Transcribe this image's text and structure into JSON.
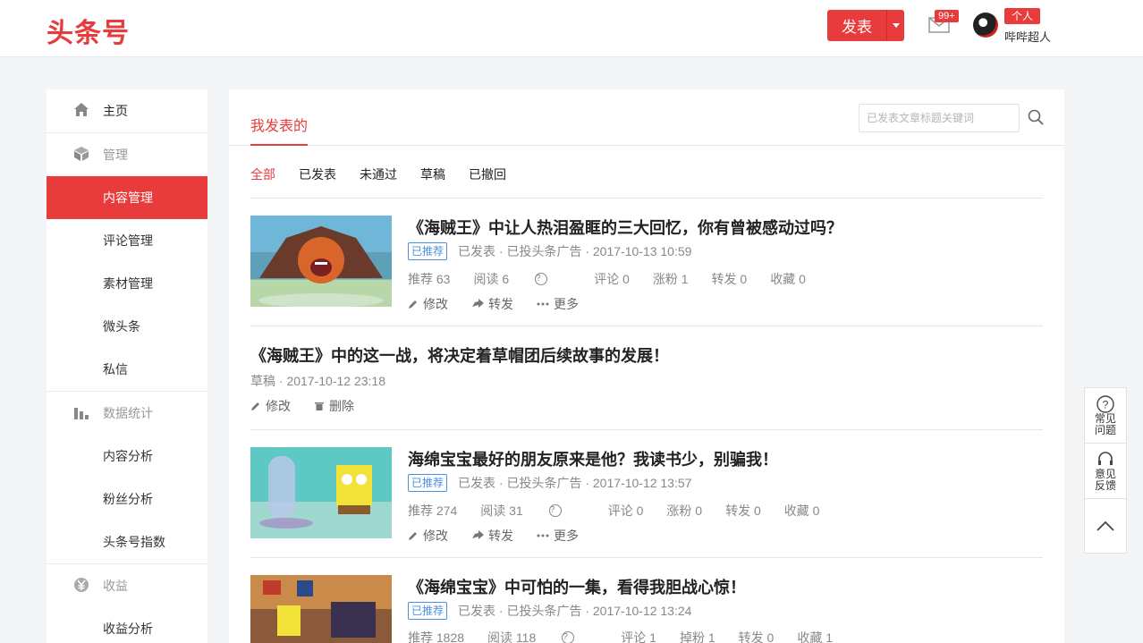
{
  "header": {
    "logo": "头条号",
    "publish_label": "发表",
    "mail_badge": "99+",
    "role_badge": "个人",
    "username": "哔哔超人"
  },
  "sidebar": {
    "items": [
      {
        "label": "主页",
        "icon": "home-icon"
      },
      {
        "label": "管理",
        "icon": "cube-icon"
      },
      {
        "label": "内容管理"
      },
      {
        "label": "评论管理"
      },
      {
        "label": "素材管理"
      },
      {
        "label": "微头条"
      },
      {
        "label": "私信"
      },
      {
        "label": "数据统计",
        "icon": "bar-chart-icon"
      },
      {
        "label": "内容分析"
      },
      {
        "label": "粉丝分析"
      },
      {
        "label": "头条号指数"
      },
      {
        "label": "收益",
        "icon": "yen-icon"
      },
      {
        "label": "收益分析"
      }
    ]
  },
  "main": {
    "title": "我发表的",
    "search_placeholder": "已发表文章标题关键词",
    "filters": [
      "全部",
      "已发表",
      "未通过",
      "草稿",
      "已撤回"
    ],
    "articles": [
      {
        "title": "《海贼王》中让人热泪盈眶的三大回忆，你有曾被感动过吗？",
        "tag": "已推荐",
        "status": "已发表 · 已投头条广告 · 2017-10-13 10:59",
        "stats": [
          "推荐 63",
          "阅读 6",
          "评论 0",
          "涨粉 1",
          "转发 0",
          "收藏 0"
        ],
        "actions": [
          "修改",
          "转发",
          "更多"
        ]
      },
      {
        "title": "《海贼王》中的这一战，将决定着草帽团后续故事的发展！",
        "status": "草稿 · 2017-10-12 23:18",
        "actions": [
          "修改",
          "删除"
        ]
      },
      {
        "title": "海绵宝宝最好的朋友原来是他？我读书少，别骗我！",
        "tag": "已推荐",
        "status": "已发表 · 已投头条广告 · 2017-10-12 13:57",
        "stats": [
          "推荐 274",
          "阅读 31",
          "评论 0",
          "涨粉 0",
          "转发 0",
          "收藏 0"
        ],
        "actions": [
          "修改",
          "转发",
          "更多"
        ]
      },
      {
        "title": "《海绵宝宝》中可怕的一集，看得我胆战心惊！",
        "tag": "已推荐",
        "status": "已发表 · 已投头条广告 · 2017-10-12 13:24",
        "stats": [
          "推荐 1828",
          "阅读 118",
          "评论 1",
          "掉粉 1",
          "转发 0",
          "收藏 1"
        ]
      }
    ]
  },
  "tools": {
    "faq": "常见问题",
    "feedback": "意见反馈"
  },
  "colors": {
    "accent": "#e83b3b",
    "tag_blue": "#4a90e2"
  }
}
